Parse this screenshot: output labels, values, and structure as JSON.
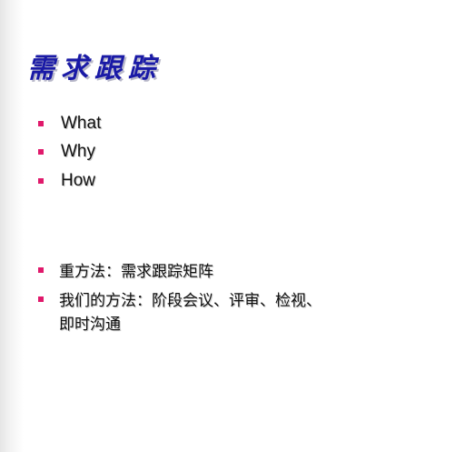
{
  "slide": {
    "title": "需求跟踪",
    "bullets_top": [
      {
        "text": "What"
      },
      {
        "text": "Why"
      },
      {
        "text": "How"
      }
    ],
    "bullets_bottom": [
      {
        "lines": [
          "重方法：需求跟踪矩阵"
        ]
      },
      {
        "lines": [
          "我们的方法：阶段会议、评审、检视、",
          "即时沟通"
        ]
      }
    ],
    "colors": {
      "title": "#1a1aa6",
      "bullet": "#e0196b",
      "text": "#111111"
    }
  }
}
